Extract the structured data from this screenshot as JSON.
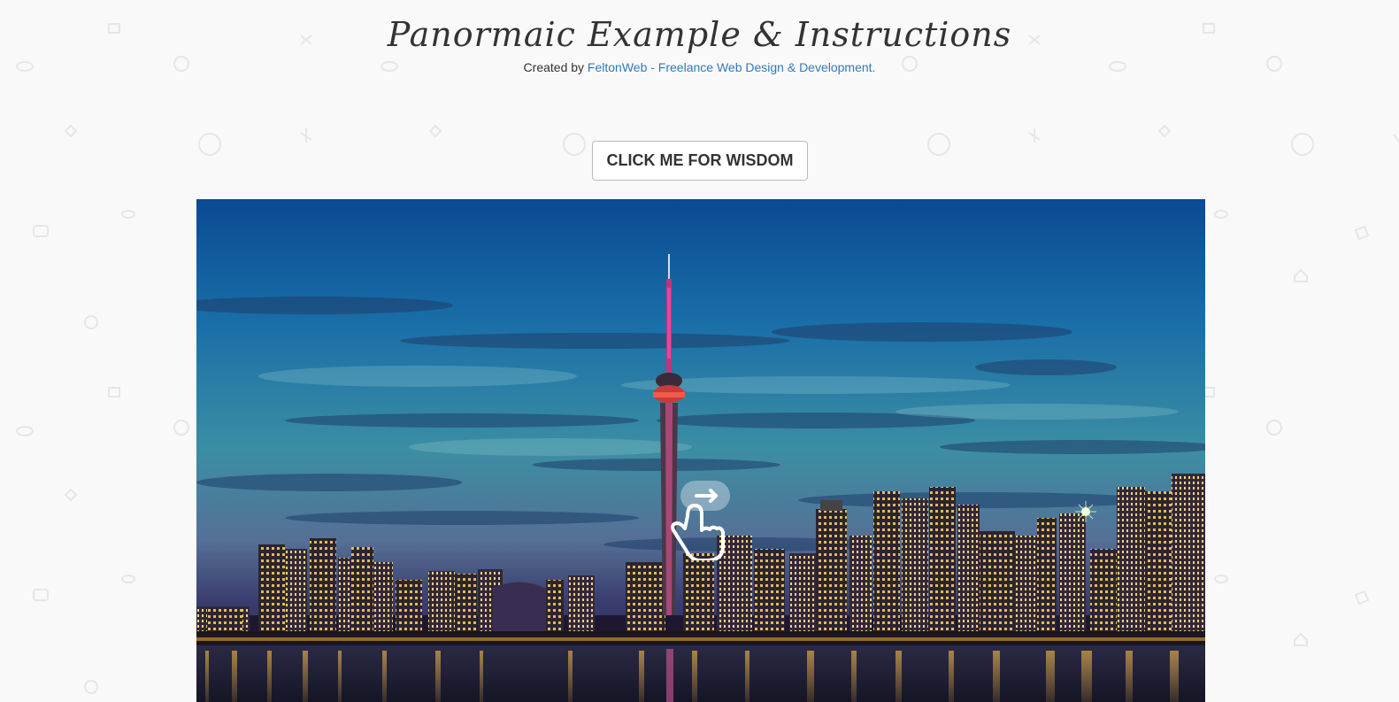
{
  "header": {
    "title": "Panormaic Example & Instructions",
    "created_by_prefix": "Created by ",
    "created_by_link": "FeltonWeb - Freelance Web Design & Development."
  },
  "wisdom_button": {
    "label": "CLICK ME FOR WISDOM"
  },
  "panorama": {
    "icons": {
      "swipe_hint": "swipe-hand-icon"
    }
  },
  "colors": {
    "link": "#337ab7",
    "text": "#333333",
    "background": "#f9f9f9"
  }
}
